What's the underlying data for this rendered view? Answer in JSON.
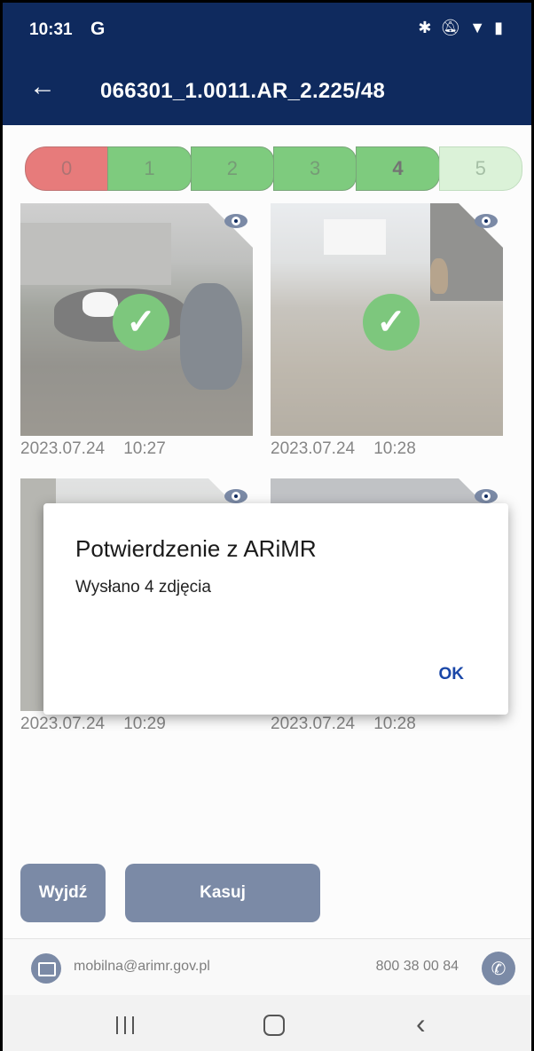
{
  "status": {
    "time": "10:31",
    "g_icon": "G",
    "icons": [
      "bluetooth-icon",
      "bell-off-icon",
      "wifi-icon",
      "battery-icon"
    ]
  },
  "appbar": {
    "title": "066301_1.0011.AR_2.225/48"
  },
  "rating": {
    "labels": [
      "0",
      "1",
      "2",
      "3",
      "4",
      "5"
    ],
    "selected": "4"
  },
  "photos": [
    {
      "date": "2023.07.24",
      "time": "10:27",
      "sent": true
    },
    {
      "date": "2023.07.24",
      "time": "10:28",
      "sent": true
    },
    {
      "date": "2023.07.24",
      "time": "10:29",
      "sent": false
    },
    {
      "date": "2023.07.24",
      "time": "10:28",
      "sent": false
    }
  ],
  "buttons": {
    "exit": "Wyjdź",
    "delete": "Kasuj"
  },
  "footer": {
    "email": "mobilna@arimr.gov.pl",
    "phone": "800 38 00 84"
  },
  "dialog": {
    "title": "Potwierdzenie z ARiMR",
    "message": "Wysłano 4 zdjęcia",
    "ok": "OK"
  },
  "colors": {
    "primary": "#0f2a5e",
    "green": "#15a015",
    "red": "#d41010",
    "accent_link": "#1a47a8"
  }
}
